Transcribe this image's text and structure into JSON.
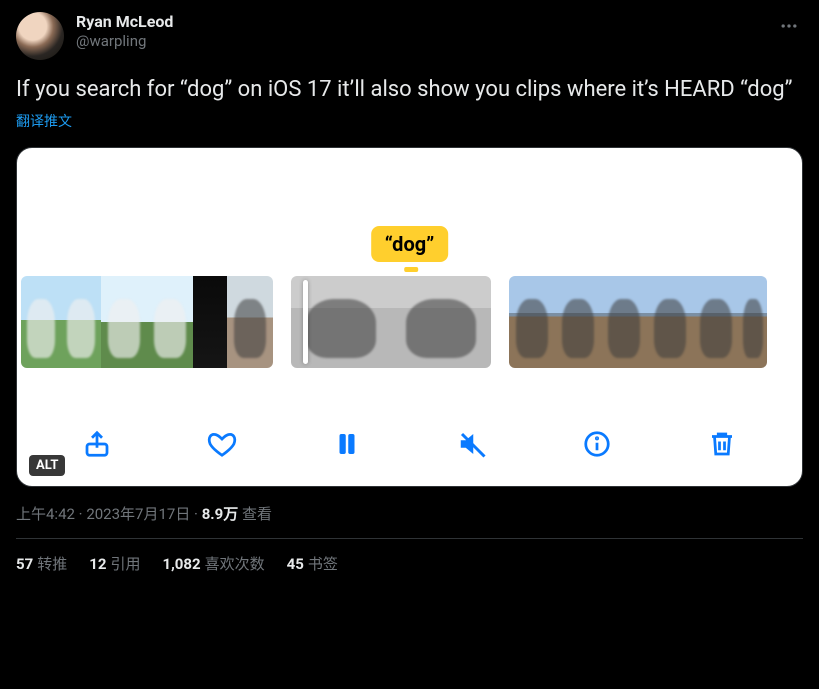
{
  "author": {
    "display_name": "Ryan McLeod",
    "username": "@warpling"
  },
  "tweet_text": "If you search for “dog” on iOS 17 it’ll also show you clips where it’s HEARD “dog”",
  "translate_label": "翻译推文",
  "media": {
    "tag": "“dog”",
    "alt_badge": "ALT"
  },
  "meta": {
    "time": "上午4:42",
    "sep1": " · ",
    "date": "2023年7月17日",
    "sep2": " · ",
    "views_count": "8.9万",
    "views_label": " 查看"
  },
  "stats": {
    "retweets": {
      "count": "57",
      "label": "转推"
    },
    "quotes": {
      "count": "12",
      "label": "引用"
    },
    "likes": {
      "count": "1,082",
      "label": "喜欢次数"
    },
    "bookmarks": {
      "count": "45",
      "label": "书签"
    }
  }
}
